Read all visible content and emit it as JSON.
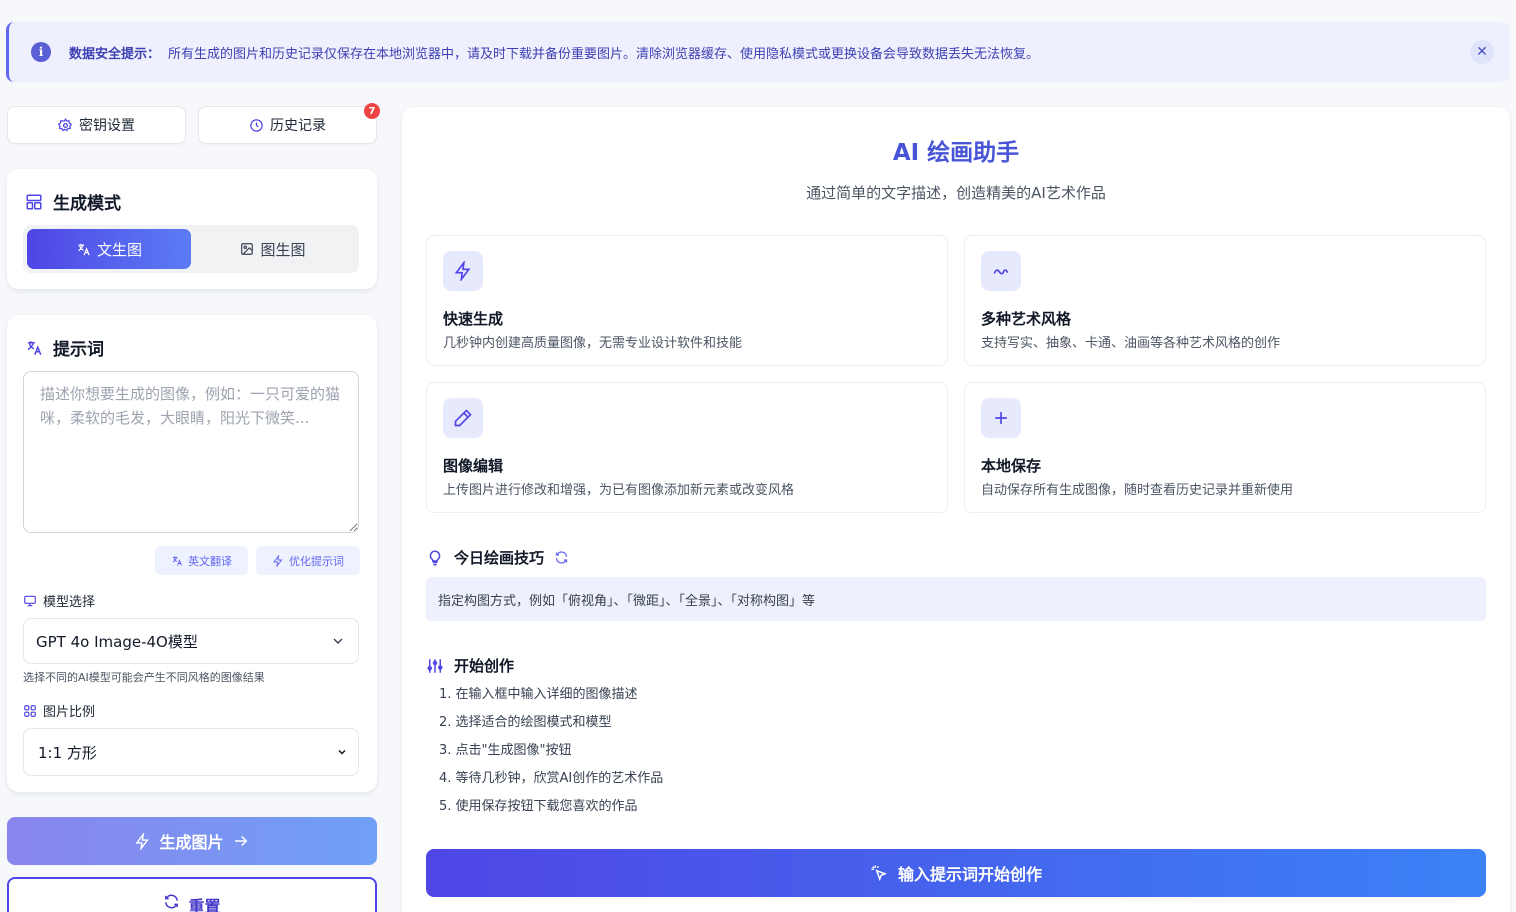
{
  "notice": {
    "label": "数据安全提示：",
    "text": "所有生成的图片和历史记录仅保存在本地浏览器中，请及时下载并备份重要图片。清除浏览器缓存、使用隐私模式或更换设备会导致数据丢失无法恢复。",
    "icon": "info-icon",
    "close_icon": "close-icon"
  },
  "toolbar": {
    "key_settings": "密钥设置",
    "history": "历史记录",
    "history_count": "7"
  },
  "mode": {
    "title": "生成模式",
    "text_to_image": "文生图",
    "image_to_image": "图生图",
    "active": "文生图"
  },
  "prompt": {
    "title": "提示词",
    "placeholder": "描述你想要生成的图像，例如：一只可爱的猫咪，柔软的毛发，大眼睛，阳光下微笑...",
    "value": "",
    "translate": "英文翻译",
    "optimize": "优化提示词"
  },
  "model": {
    "label": "模型选择",
    "selected": "GPT 4o Image-4O模型",
    "hint": "选择不同的AI模型可能会产生不同风格的图像结果"
  },
  "ratio": {
    "label": "图片比例",
    "selected": "1:1 方形"
  },
  "actions": {
    "generate": "生成图片",
    "reset": "重置"
  },
  "main": {
    "title": "AI 绘画助手",
    "subtitle": "通过简单的文字描述，创造精美的AI艺术作品",
    "features": [
      {
        "title": "快速生成",
        "desc": "几秒钟内创建高质量图像，无需专业设计软件和技能",
        "icon": "lightning-icon"
      },
      {
        "title": "多种艺术风格",
        "desc": "支持写实、抽象、卡通、油画等各种艺术风格的创作",
        "icon": "wave-icon"
      },
      {
        "title": "图像编辑",
        "desc": "上传图片进行修改和增强，为已有图像添加新元素或改变风格",
        "icon": "pencil-icon"
      },
      {
        "title": "本地保存",
        "desc": "自动保存所有生成图像，随时查看历史记录并重新使用",
        "icon": "plus-icon"
      }
    ],
    "tip_title": "今日绘画技巧",
    "tip_text": "指定构图方式，例如「俯视角」、「微距」、「全景」、「对称构图」等",
    "start_title": "开始创作",
    "steps": [
      "1. 在输入框中输入详细的图像描述",
      "2. 选择适合的绘图模式和模型",
      "3. 点击\"生成图像\"按钮",
      "4. 等待几秒钟，欣赏AI创作的艺术作品",
      "5. 使用保存按钮下载您喜欢的作品"
    ],
    "cta": "输入提示词开始创作"
  },
  "colors": {
    "accent": "#4f46e5",
    "accent_light": "#eef1fd",
    "badge": "#ef4444"
  }
}
